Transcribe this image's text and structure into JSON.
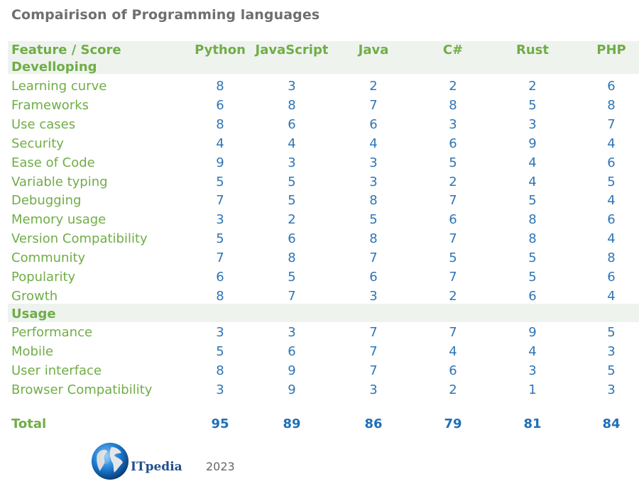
{
  "title": "Compairison of Programming languages",
  "header": {
    "feature_label": "Feature / Score",
    "languages": [
      "Python",
      "JavaScript",
      "Java",
      "C#",
      "Rust",
      "PHP"
    ]
  },
  "sections": [
    {
      "name": "Develloping",
      "rows": [
        {
          "label": "Learning curve",
          "values": [
            "8",
            "3",
            "2",
            "2",
            "2",
            "6"
          ]
        },
        {
          "label": "Frameworks",
          "values": [
            "6",
            "8",
            "7",
            "8",
            "5",
            "8"
          ]
        },
        {
          "label": "Use cases",
          "values": [
            "8",
            "6",
            "6",
            "3",
            "3",
            "7"
          ]
        },
        {
          "label": "Security",
          "values": [
            "4",
            "4",
            "4",
            "6",
            "9",
            "4"
          ]
        },
        {
          "label": "Ease of Code",
          "values": [
            "9",
            "3",
            "3",
            "5",
            "4",
            "6"
          ]
        },
        {
          "label": "Variable typing",
          "values": [
            "5",
            "5",
            "3",
            "2",
            "4",
            "5"
          ]
        },
        {
          "label": "Debugging",
          "values": [
            "7",
            "5",
            "8",
            "7",
            "5",
            "4"
          ]
        },
        {
          "label": "Memory usage",
          "values": [
            "3",
            "2",
            "5",
            "6",
            "8",
            "6"
          ]
        },
        {
          "label": "Version Compatibility",
          "values": [
            "5",
            "6",
            "8",
            "7",
            "8",
            "4"
          ]
        },
        {
          "label": "Community",
          "values": [
            "7",
            "8",
            "7",
            "5",
            "5",
            "8"
          ]
        },
        {
          "label": "Popularity",
          "values": [
            "6",
            "5",
            "6",
            "7",
            "5",
            "6"
          ]
        },
        {
          "label": "Growth",
          "values": [
            "8",
            "7",
            "3",
            "2",
            "6",
            "4"
          ]
        }
      ]
    },
    {
      "name": "Usage",
      "rows": [
        {
          "label": "Performance",
          "values": [
            "3",
            "3",
            "7",
            "7",
            "9",
            "5"
          ]
        },
        {
          "label": "Mobile",
          "values": [
            "5",
            "6",
            "7",
            "4",
            "4",
            "3"
          ]
        },
        {
          "label": "User interface",
          "values": [
            "8",
            "9",
            "7",
            "6",
            "3",
            "5"
          ]
        },
        {
          "label": "Browser Compatibility",
          "values": [
            "3",
            "9",
            "3",
            "2",
            "1",
            "3"
          ]
        }
      ]
    }
  ],
  "total": {
    "label": "Total",
    "values": [
      "95",
      "89",
      "86",
      "79",
      "81",
      "84"
    ]
  },
  "footer": {
    "brand": "ITpedia",
    "year": "2023",
    "logo_icon": "globe-icon"
  },
  "colors": {
    "title": "#6e6e70",
    "label_green": "#70ad47",
    "value_blue": "#2e75b6",
    "band_bg": "#eef3ee"
  }
}
